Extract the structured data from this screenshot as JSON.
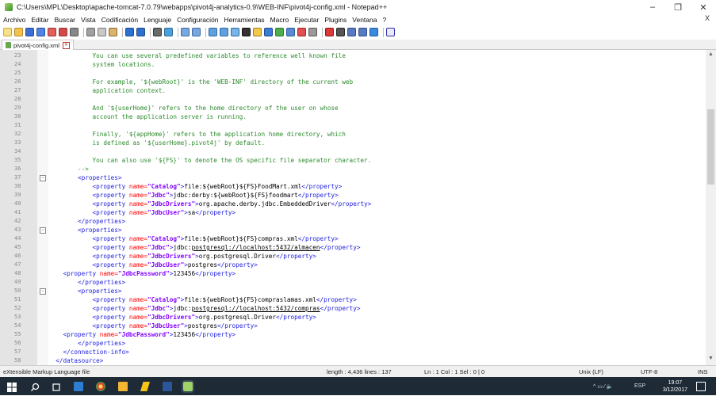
{
  "window": {
    "title": "C:\\Users\\MPL\\Desktop\\apache-tomcat-7.0.79\\webapps\\pivot4j-analytics-0.9\\WEB-INF\\pivot4j-config.xml - Notepad++",
    "minimize": "–",
    "maximize": "❐",
    "close": "✕"
  },
  "menu": {
    "items": [
      "Archivo",
      "Editar",
      "Buscar",
      "Vista",
      "Codificación",
      "Lenguaje",
      "Configuración",
      "Herramientas",
      "Macro",
      "Ejecutar",
      "Plugins",
      "Ventana",
      "?"
    ],
    "close": "X"
  },
  "tab": {
    "label": "pivot4j-config.xml"
  },
  "editor": {
    "lines": [
      {
        "n": "23",
        "parts": [
          {
            "t": "            You can use several predefined variables to reference well known file",
            "c": "cmt"
          }
        ]
      },
      {
        "n": "24",
        "parts": [
          {
            "t": "            system locations.",
            "c": "cmt"
          }
        ]
      },
      {
        "n": "25",
        "parts": []
      },
      {
        "n": "26",
        "parts": [
          {
            "t": "            For example, '${webRoot}' is the 'WEB-INF' directory of the current web",
            "c": "cmt"
          }
        ]
      },
      {
        "n": "27",
        "parts": [
          {
            "t": "            application context.",
            "c": "cmt"
          }
        ]
      },
      {
        "n": "28",
        "parts": []
      },
      {
        "n": "29",
        "parts": [
          {
            "t": "            And '${userHome}' refers to the home directory of the user on whose",
            "c": "cmt"
          }
        ]
      },
      {
        "n": "30",
        "parts": [
          {
            "t": "            account the application server is running.",
            "c": "cmt"
          }
        ]
      },
      {
        "n": "31",
        "parts": []
      },
      {
        "n": "32",
        "parts": [
          {
            "t": "            Finally, '${appHome}' refers to the application home directory, which",
            "c": "cmt"
          }
        ]
      },
      {
        "n": "33",
        "parts": [
          {
            "t": "            is defined as '${userHome}.pivot4j' by default.",
            "c": "cmt"
          }
        ]
      },
      {
        "n": "34",
        "parts": []
      },
      {
        "n": "35",
        "parts": [
          {
            "t": "            You can also use '${FS}' to denote the OS specific file separator character.",
            "c": "cmt"
          }
        ]
      },
      {
        "n": "36",
        "parts": [
          {
            "t": "        -->",
            "c": "cmt"
          }
        ]
      },
      {
        "n": "37",
        "fold": true,
        "parts": [
          {
            "t": "        <properties>",
            "c": "tag"
          }
        ]
      },
      {
        "n": "38",
        "parts": [
          {
            "t": "            <property ",
            "c": "tag"
          },
          {
            "t": "name=",
            "c": "attr"
          },
          {
            "t": "\"Catalog\"",
            "c": "val"
          },
          {
            "t": ">",
            "c": "tag"
          },
          {
            "t": "file:${webRoot}${FS}FoodMart.xml",
            "c": "txt"
          },
          {
            "t": "</property>",
            "c": "tag"
          }
        ]
      },
      {
        "n": "39",
        "parts": [
          {
            "t": "            <property ",
            "c": "tag"
          },
          {
            "t": "name=",
            "c": "attr"
          },
          {
            "t": "\"Jdbc\"",
            "c": "val"
          },
          {
            "t": ">",
            "c": "tag"
          },
          {
            "t": "jdbc:derby:${webRoot}${FS}foodmart",
            "c": "txt"
          },
          {
            "t": "</property>",
            "c": "tag"
          }
        ]
      },
      {
        "n": "40",
        "parts": [
          {
            "t": "            <property ",
            "c": "tag"
          },
          {
            "t": "name=",
            "c": "attr"
          },
          {
            "t": "\"JdbcDrivers\"",
            "c": "val"
          },
          {
            "t": ">",
            "c": "tag"
          },
          {
            "t": "org.apache.derby.jdbc.EmbeddedDriver",
            "c": "txt"
          },
          {
            "t": "</property>",
            "c": "tag"
          }
        ]
      },
      {
        "n": "41",
        "parts": [
          {
            "t": "            <property ",
            "c": "tag"
          },
          {
            "t": "name=",
            "c": "attr"
          },
          {
            "t": "\"JdbcUser\"",
            "c": "val"
          },
          {
            "t": ">",
            "c": "tag"
          },
          {
            "t": "sa",
            "c": "txt"
          },
          {
            "t": "</property>",
            "c": "tag"
          }
        ]
      },
      {
        "n": "42",
        "parts": [
          {
            "t": "        </properties>",
            "c": "tag"
          }
        ]
      },
      {
        "n": "43",
        "fold": true,
        "parts": [
          {
            "t": "        <properties>",
            "c": "tag"
          }
        ]
      },
      {
        "n": "44",
        "parts": [
          {
            "t": "            <property ",
            "c": "tag"
          },
          {
            "t": "name=",
            "c": "attr"
          },
          {
            "t": "\"Catalog\"",
            "c": "val"
          },
          {
            "t": ">",
            "c": "tag"
          },
          {
            "t": "file:${webRoot}${FS}compras.xml",
            "c": "txt"
          },
          {
            "t": "</property>",
            "c": "tag"
          }
        ]
      },
      {
        "n": "45",
        "parts": [
          {
            "t": "            <property ",
            "c": "tag"
          },
          {
            "t": "name=",
            "c": "attr"
          },
          {
            "t": "\"Jdbc\"",
            "c": "val"
          },
          {
            "t": ">",
            "c": "tag"
          },
          {
            "t": "jdbc:",
            "c": "txt"
          },
          {
            "t": "postgresql://localhost:5432/almacen",
            "c": "txt",
            "u": true
          },
          {
            "t": "</property>",
            "c": "tag"
          }
        ]
      },
      {
        "n": "46",
        "parts": [
          {
            "t": "            <property ",
            "c": "tag"
          },
          {
            "t": "name=",
            "c": "attr"
          },
          {
            "t": "\"JdbcDrivers\"",
            "c": "val"
          },
          {
            "t": ">",
            "c": "tag"
          },
          {
            "t": "org.postgresql.Driver",
            "c": "txt"
          },
          {
            "t": "</property>",
            "c": "tag"
          }
        ]
      },
      {
        "n": "47",
        "parts": [
          {
            "t": "            <property ",
            "c": "tag"
          },
          {
            "t": "name=",
            "c": "attr"
          },
          {
            "t": "\"JdbcUser\"",
            "c": "val"
          },
          {
            "t": ">",
            "c": "tag"
          },
          {
            "t": "postgres",
            "c": "txt"
          },
          {
            "t": "</property>",
            "c": "tag"
          }
        ]
      },
      {
        "n": "48",
        "parts": [
          {
            "t": "    <property ",
            "c": "tag"
          },
          {
            "t": "name=",
            "c": "attr"
          },
          {
            "t": "\"JdbcPassword\"",
            "c": "val"
          },
          {
            "t": ">",
            "c": "tag"
          },
          {
            "t": "123456",
            "c": "txt"
          },
          {
            "t": "</property>",
            "c": "tag"
          }
        ]
      },
      {
        "n": "49",
        "parts": [
          {
            "t": "        </properties>",
            "c": "tag"
          }
        ]
      },
      {
        "n": "50",
        "fold": true,
        "parts": [
          {
            "t": "        <properties>",
            "c": "tag"
          }
        ]
      },
      {
        "n": "51",
        "parts": [
          {
            "t": "            <property ",
            "c": "tag"
          },
          {
            "t": "name=",
            "c": "attr"
          },
          {
            "t": "\"Catalog\"",
            "c": "val"
          },
          {
            "t": ">",
            "c": "tag"
          },
          {
            "t": "file:${webRoot}${FS}compraslamas.xml",
            "c": "txt"
          },
          {
            "t": "</property>",
            "c": "tag"
          }
        ]
      },
      {
        "n": "52",
        "parts": [
          {
            "t": "            <property ",
            "c": "tag"
          },
          {
            "t": "name=",
            "c": "attr"
          },
          {
            "t": "\"Jdbc\"",
            "c": "val"
          },
          {
            "t": ">",
            "c": "tag"
          },
          {
            "t": "jdbc:",
            "c": "txt"
          },
          {
            "t": "postgresql://localhost:5432/compras",
            "c": "txt",
            "u": true
          },
          {
            "t": "</property>",
            "c": "tag"
          }
        ]
      },
      {
        "n": "53",
        "parts": [
          {
            "t": "            <property ",
            "c": "tag"
          },
          {
            "t": "name=",
            "c": "attr"
          },
          {
            "t": "\"JdbcDrivers\"",
            "c": "val"
          },
          {
            "t": ">",
            "c": "tag"
          },
          {
            "t": "org.postgresql.Driver",
            "c": "txt"
          },
          {
            "t": "</property>",
            "c": "tag"
          }
        ]
      },
      {
        "n": "54",
        "parts": [
          {
            "t": "            <property ",
            "c": "tag"
          },
          {
            "t": "name=",
            "c": "attr"
          },
          {
            "t": "\"JdbcUser\"",
            "c": "val"
          },
          {
            "t": ">",
            "c": "tag"
          },
          {
            "t": "postgres",
            "c": "txt"
          },
          {
            "t": "</property>",
            "c": "tag"
          }
        ]
      },
      {
        "n": "55",
        "parts": [
          {
            "t": "    <property ",
            "c": "tag"
          },
          {
            "t": "name=",
            "c": "attr"
          },
          {
            "t": "\"JdbcPassword\"",
            "c": "val"
          },
          {
            "t": ">",
            "c": "tag"
          },
          {
            "t": "123456",
            "c": "txt"
          },
          {
            "t": "</property>",
            "c": "tag"
          }
        ]
      },
      {
        "n": "56",
        "parts": [
          {
            "t": "        </properties>",
            "c": "tag"
          }
        ]
      },
      {
        "n": "57",
        "parts": [
          {
            "t": "    </connection-info>",
            "c": "tag"
          }
        ]
      },
      {
        "n": "58",
        "parts": [
          {
            "t": "  </datasource>",
            "c": "tag"
          }
        ]
      }
    ]
  },
  "status": {
    "language": "eXtensible Markup Language file",
    "length": "length : 4,436   lines : 137",
    "position": "Ln : 1   Col : 1   Sel : 0 | 0",
    "eol": "Unix (LF)",
    "encoding": "UTF-8",
    "mode": "INS"
  },
  "taskbar": {
    "tray_lang": "ESP",
    "time": "19:07",
    "date": "3/12/2017"
  },
  "colors": {
    "comment": "#2e8b2e",
    "tag": "#2020e0",
    "attr": "#ff0000",
    "value": "#8000ff",
    "taskbar": "#1e2a36"
  }
}
